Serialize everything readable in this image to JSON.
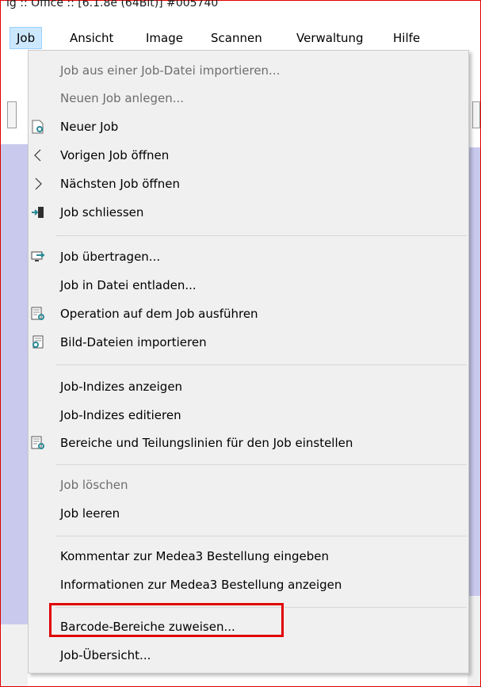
{
  "window": {
    "title": "ig :: Office :: [6.1.8e (64Bit)]  #005740"
  },
  "menubar": {
    "items": [
      "Job",
      "Ansicht",
      "Image",
      "Scannen",
      "Verwaltung",
      "Hilfe"
    ],
    "active": "Job"
  },
  "menu": {
    "entries": [
      {
        "label": "Job aus einer Job-Datei importieren...",
        "enabled": false,
        "icon": ""
      },
      {
        "label": "Neuen Job anlegen...",
        "enabled": false,
        "icon": ""
      },
      {
        "label": "Neuer Job",
        "enabled": true,
        "icon": "new-job-icon"
      },
      {
        "label": "Vorigen Job öffnen",
        "enabled": true,
        "icon": "previous-arrow-icon"
      },
      {
        "label": "Nächsten Job öffnen",
        "enabled": true,
        "icon": "next-arrow-icon"
      },
      {
        "label": "Job schliessen",
        "enabled": true,
        "icon": "close-job-door-icon"
      },
      {
        "label": "Job übertragen...",
        "enabled": true,
        "icon": "transfer-monitor-icon"
      },
      {
        "label": "Job in Datei entladen...",
        "enabled": true,
        "icon": ""
      },
      {
        "label": "Operation auf dem Job ausführen",
        "enabled": true,
        "icon": "operation-icon"
      },
      {
        "label": "Bild-Dateien importieren",
        "enabled": true,
        "icon": "import-images-icon"
      },
      {
        "label": "Job-Indizes anzeigen",
        "enabled": true,
        "icon": ""
      },
      {
        "label": "Job-Indizes editieren",
        "enabled": true,
        "icon": ""
      },
      {
        "label": "Bereiche und Teilungslinien für den Job einstellen",
        "enabled": true,
        "icon": "areas-settings-icon"
      },
      {
        "label": "Job löschen",
        "enabled": false,
        "icon": ""
      },
      {
        "label": "Job leeren",
        "enabled": true,
        "icon": ""
      },
      {
        "label": "Kommentar zur Medea3 Bestellung eingeben",
        "enabled": true,
        "icon": ""
      },
      {
        "label": "Informationen zur Medea3 Bestellung anzeigen",
        "enabled": true,
        "icon": ""
      },
      {
        "label": "Barcode-Bereiche zuweisen...",
        "enabled": true,
        "icon": "",
        "highlighted": true
      },
      {
        "label": "Job-Übersicht...",
        "enabled": true,
        "icon": ""
      }
    ]
  },
  "colors": {
    "menu_bg": "#f0f0f0",
    "active_menu_bg": "#cce8ff",
    "highlight_border": "#e00000",
    "app_bg_lavender": "#c9c9ee",
    "icon_teal": "#2a8a96"
  }
}
